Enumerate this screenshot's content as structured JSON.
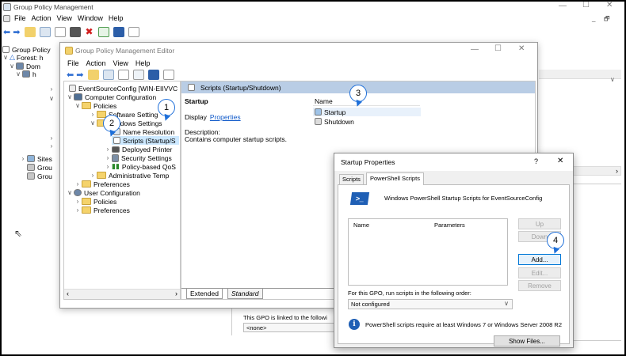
{
  "outer": {
    "title": "Group Policy Management",
    "menu": [
      "File",
      "Action",
      "View",
      "Window",
      "Help"
    ],
    "tree": [
      "Group Policy",
      "Forest: h",
      "Dom",
      "h",
      "Sites",
      "Grou",
      "Grou"
    ],
    "gpo_link_text": "This GPO is linked to the followi",
    "gpo_link_value": "<none>"
  },
  "editor": {
    "title": "Group Policy Management Editor",
    "menu": [
      "File",
      "Action",
      "View",
      "Help"
    ],
    "tree": {
      "root": "EventSourceConfig [WIN-EIIVVC",
      "computer_config": "Computer Configuration",
      "policies": "Policies",
      "software_settings": "Software Setting",
      "windows_settings": "Windows Settings",
      "name_resolution": "Name Resolution",
      "scripts": "Scripts (Startup/S",
      "deployed_printers": "Deployed Printer",
      "security_settings": "Security Settings",
      "policy_qos": "Policy-based QoS",
      "admin_templates": "Administrative Temp",
      "preferences": "Preferences",
      "user_config": "User Configuration",
      "user_policies": "Policies",
      "user_preferences": "Preferences"
    },
    "detail": {
      "header": "Scripts (Startup/Shutdown)",
      "section_title": "Startup",
      "display_label": "Display",
      "properties_link": "Properties",
      "description_label": "Description:",
      "description_text": "Contains computer startup scripts.",
      "list_header": "Name",
      "list_items": [
        "Startup",
        "Shutdown"
      ]
    },
    "tabs": [
      "Extended",
      "Standard"
    ]
  },
  "dialog": {
    "title": "Startup Properties",
    "help": "?",
    "close": "✕",
    "tabs": [
      "Scripts",
      "PowerShell Scripts"
    ],
    "heading": "Windows PowerShell Startup Scripts for EventSourceConfig",
    "columns": [
      "Name",
      "Parameters"
    ],
    "buttons": {
      "up": "Up",
      "down": "Down",
      "add": "Add...",
      "edit": "Edit...",
      "remove": "Remove",
      "show_files": "Show Files..."
    },
    "order_label": "For this GPO, run scripts in the following order:",
    "order_value": "Not configured",
    "info": "PowerShell scripts require at least Windows 7 or Windows Server 2008 R2"
  },
  "callouts": [
    "1",
    "2",
    "3",
    "4"
  ],
  "colors": {
    "accent": "#1e6fd9",
    "selection": "#cce8ff",
    "header_blue": "#b9cde5",
    "link": "#0b56c8"
  }
}
